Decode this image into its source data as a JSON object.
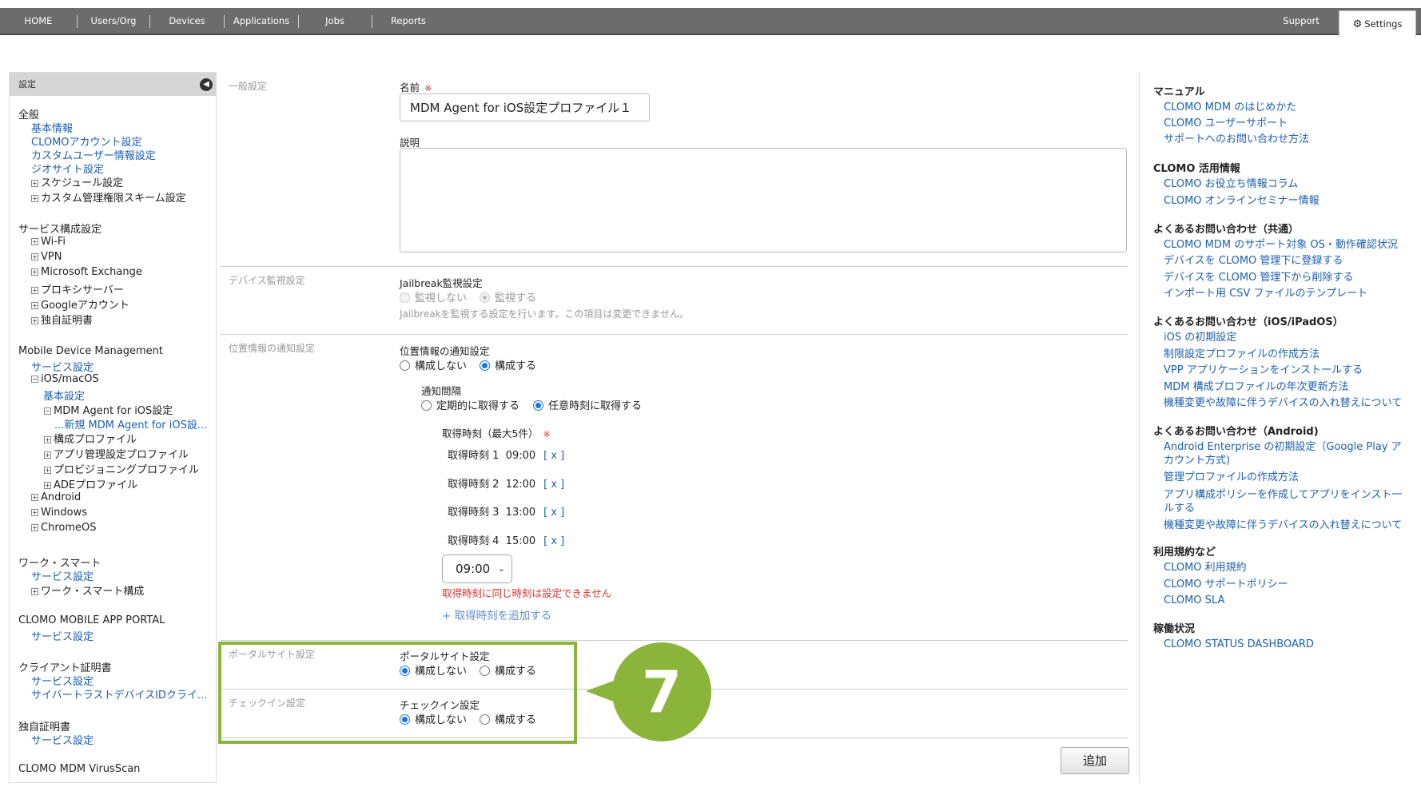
{
  "nav": {
    "items": [
      "HOME",
      "Users/Org",
      "Devices",
      "Applications",
      "Jobs",
      "Reports"
    ],
    "support": "Support",
    "settings": "Settings"
  },
  "sidebar": {
    "header": "設定",
    "general": {
      "title": "全般",
      "links": [
        "基本情報",
        "CLOMOアカウント設定",
        "カスタムユーザー情報設定",
        "ジオサイト設定"
      ],
      "trees": [
        "スケジュール設定",
        "カスタム管理権限スキーム設定"
      ]
    },
    "service": {
      "title": "サービス構成設定",
      "trees": [
        "Wi-Fi",
        "VPN",
        "Microsoft Exchange",
        "プロキシサーバー",
        "Googleアカウント",
        "独自証明書"
      ]
    },
    "mdm": {
      "title": "Mobile Device Management",
      "link": "サービス設定",
      "ios": "iOS/macOS",
      "basic": "基本設定",
      "agent": "MDM Agent for iOS設定",
      "agent_new": "...新規 MDM Agent for iOS設...",
      "profiles": [
        "構成プロファイル",
        "アプリ管理設定プロファイル",
        "プロビジョニングプロファイル",
        "ADEプロファイル"
      ],
      "others": [
        "Android",
        "Windows",
        "ChromeOS"
      ]
    },
    "work": {
      "title": "ワーク・スマート",
      "link": "サービス設定",
      "tree": "ワーク・スマート構成"
    },
    "portal": {
      "title": "CLOMO MOBILE APP PORTAL",
      "link": "サービス設定"
    },
    "client": {
      "title": "クライアント証明書",
      "links": [
        "サービス設定",
        "サイバートラストデバイスIDクライ..."
      ]
    },
    "cert": {
      "title": "独自証明書",
      "link": "サービス設定"
    },
    "virus": {
      "title": "CLOMO MDM VirusScan"
    }
  },
  "form": {
    "general_label": "一般設定",
    "name_label": "名前",
    "required_mark": "※",
    "name_value": "MDM Agent for iOS設定プロファイル１",
    "desc_label": "説明",
    "device_label": "デバイス監視設定",
    "jailbreak_label": "Jailbreak監視設定",
    "jb_off": "監視しない",
    "jb_on": "監視する",
    "jb_note": "Jailbreakを監視する設定を行います。この項目は変更できません。",
    "loc_label": "位置情報の通知設定",
    "loc_field": "位置情報の通知設定",
    "no_config": "構成しない",
    "config": "構成する",
    "interval_label": "通知間隔",
    "periodic": "定期的に取得する",
    "arbitrary": "任意時刻に取得する",
    "times_label": "取得時刻（最大5件）",
    "times": [
      {
        "label": "取得時刻 1",
        "time": "09:00"
      },
      {
        "label": "取得時刻 2",
        "time": "12:00"
      },
      {
        "label": "取得時刻 3",
        "time": "13:00"
      },
      {
        "label": "取得時刻 4",
        "time": "15:00"
      }
    ],
    "remove": "[ x ]",
    "select_value": "09:00",
    "error": "取得時刻に同じ時刻は設定できません",
    "add_time": "+ 取得時刻を追加する",
    "portal_label": "ポータルサイト設定",
    "portal_field": "ポータルサイト設定",
    "checkin_label": "チェックイン設定",
    "checkin_field": "チェックイン設定",
    "add_button": "追加",
    "step": "7"
  },
  "right": {
    "sections": [
      {
        "title": "マニュアル",
        "links": [
          "CLOMO MDM のはじめかた",
          "CLOMO ユーザーサポート",
          "サポートへのお問い合わせ方法"
        ]
      },
      {
        "title": "CLOMO 活用情報",
        "links": [
          "CLOMO お役立ち情報コラム",
          "CLOMO オンラインセミナー情報"
        ]
      },
      {
        "title": "よくあるお問い合わせ（共通）",
        "links": [
          "CLOMO MDM のサポート対象 OS・動作確認状況",
          "デバイスを CLOMO 管理下に登録する",
          "デバイスを CLOMO 管理下から削除する",
          "インポート用 CSV ファイルのテンプレート"
        ]
      },
      {
        "title": "よくあるお問い合わせ（iOS/iPadOS）",
        "links": [
          "iOS の初期設定",
          "制限設定プロファイルの作成方法",
          "VPP アプリケーションをインストールする",
          "MDM 構成プロファイルの年次更新方法",
          "機種変更や故障に伴うデバイスの入れ替えについて"
        ]
      },
      {
        "title": "よくあるお問い合わせ（Android)",
        "links": [
          "Android Enterprise の初期設定（Google Play ア",
          "カウント方式)",
          "管理プロファイルの作成方法",
          "アプリ構成ポリシーを作成してアプリをインスト一",
          "ルする",
          "機種変更や故障に伴うデバイスの入れ替えについて"
        ]
      },
      {
        "title": "利用規約など",
        "links": [
          "CLOMO 利用規約",
          "CLOMO サポートポリシー",
          "CLOMO SLA"
        ]
      },
      {
        "title": "稼働状況",
        "links": [
          "CLOMO STATUS DASHBOARD"
        ]
      }
    ]
  }
}
